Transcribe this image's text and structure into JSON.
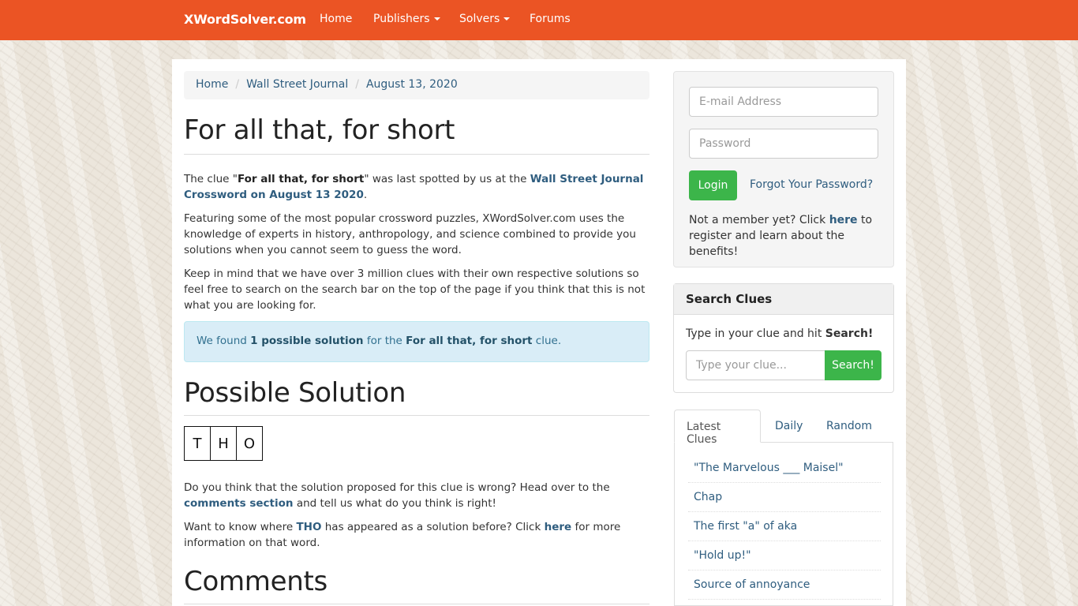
{
  "nav": {
    "brand": "XWordSolver.com",
    "items": [
      "Home",
      "Publishers",
      "Solvers",
      "Forums"
    ]
  },
  "breadcrumb": [
    "Home",
    "Wall Street Journal",
    "August 13, 2020"
  ],
  "main": {
    "title": "For all that, for short",
    "intro": {
      "t1": "The clue \"",
      "clue": "For all that, for short",
      "t2": "\" was last spotted by us at the ",
      "link": "Wall Street Journal Crossword on August 13 2020",
      "t3": "."
    },
    "para2": "Featuring some of the most popular crossword puzzles, XWordSolver.com uses the knowledge of experts in history, anthropology, and science combined to provide you solutions when you cannot seem to guess the word.",
    "para3": "Keep in mind that we have over 3 million clues with their own respective solutions so feel free to search on the search bar on the top of the page if you think that this is not what you are looking for.",
    "alert": {
      "t1": "We found ",
      "count": "1 possible solution",
      "t2": " for the ",
      "clue": "For all that, for short",
      "t3": " clue."
    },
    "solution_heading": "Possible Solution",
    "letters": [
      "T",
      "H",
      "O"
    ],
    "wrong": {
      "t1": "Do you think that the solution proposed for this clue is wrong? Head over to the ",
      "link": "comments section",
      "t2": " and tell us what do you think is right!"
    },
    "where": {
      "t1": "Want to know where ",
      "word": "THO",
      "t2": " has appeared as a solution before? Click ",
      "link": "here",
      "t3": " for more information on that word."
    },
    "comments_heading": "Comments"
  },
  "login": {
    "email_placeholder": "E-mail Address",
    "password_placeholder": "Password",
    "login_label": "Login",
    "forgot_label": "Forgot Your Password?",
    "member_t1": "Not a member yet? Click ",
    "member_link": "here",
    "member_t2": " to register and learn about the benefits!"
  },
  "search_panel": {
    "heading": "Search Clues",
    "hint_t1": "Type in your clue and hit ",
    "hint_bold": "Search!",
    "placeholder": "Type your clue...",
    "button": "Search!"
  },
  "tabs": [
    "Latest Clues",
    "Daily",
    "Random"
  ],
  "latest_clues": [
    "\"The Marvelous ___ Maisel\"",
    "Chap",
    "The first \"a\" of aka",
    "\"Hold up!\"",
    "Source of annoyance"
  ],
  "colors": {
    "nav": "#eb5424",
    "link": "#2f5d7f",
    "button": "#3cb54a"
  }
}
